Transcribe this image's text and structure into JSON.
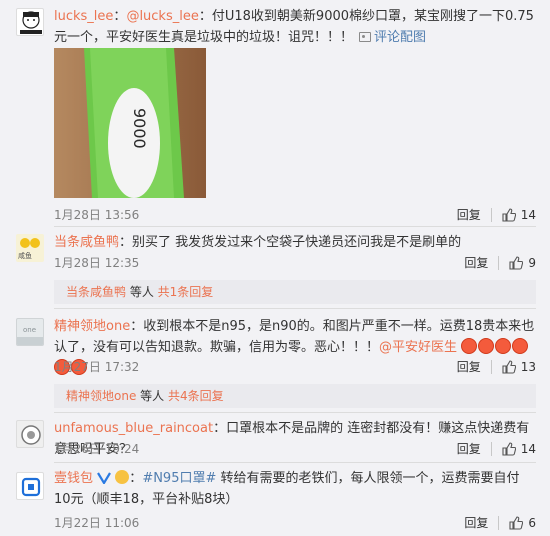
{
  "comments": [
    {
      "user": "lucks_lee",
      "text_mention": "@lucks_lee",
      "text": "：付U18收到朝美新9000棉纱口罩，某宝刚搜了一下0.75元一个，平安好医生真是垃圾中的垃圾！诅咒！！！",
      "photo_link": "评论配图",
      "time": "1月28日 13:56",
      "reply": "回复",
      "likes": "14"
    },
    {
      "user": "当条咸鱼鸭",
      "text": "：别买了 我发货发过来个空袋子快递员还问我是不是刷单的",
      "time": "1月28日 12:35",
      "reply": "回复",
      "likes": "9",
      "sub_user": "当条咸鱼鸭",
      "sub_mid": " 等人 ",
      "sub_count": "共1条回复"
    },
    {
      "user": "精神领地one",
      "text": "：收到根本不是n95，是n90的。和图片严重不一样。运费18贵本来也认了，没有可以告知退款。欺骗，信用为零。恶心！！！",
      "mention": "@平安好医生",
      "time": "1月27日 17:32",
      "reply": "回复",
      "likes": "13",
      "sub_user": "精神领地one",
      "sub_mid": " 等人 ",
      "sub_count": "共4条回复"
    },
    {
      "user": "unfamous_blue_raincoat",
      "text": "：口罩根本不是品牌的 连密封都没有！赚这点快递费有意思吗平安？",
      "time": "1月26日 19:24",
      "reply": "回复",
      "likes": "14"
    },
    {
      "user": "壹钱包",
      "topic": "#N95口罩#",
      "text": " 转给有需要的老铁们，每人限领一个，运费需要自付10元（顺丰18，平台补贴8块）",
      "time": "1月22日 11:06",
      "reply": "回复",
      "likes": "6"
    }
  ],
  "colors": {
    "link": "#eb7350",
    "muted": "#808080",
    "background": "#f2f2f5"
  }
}
